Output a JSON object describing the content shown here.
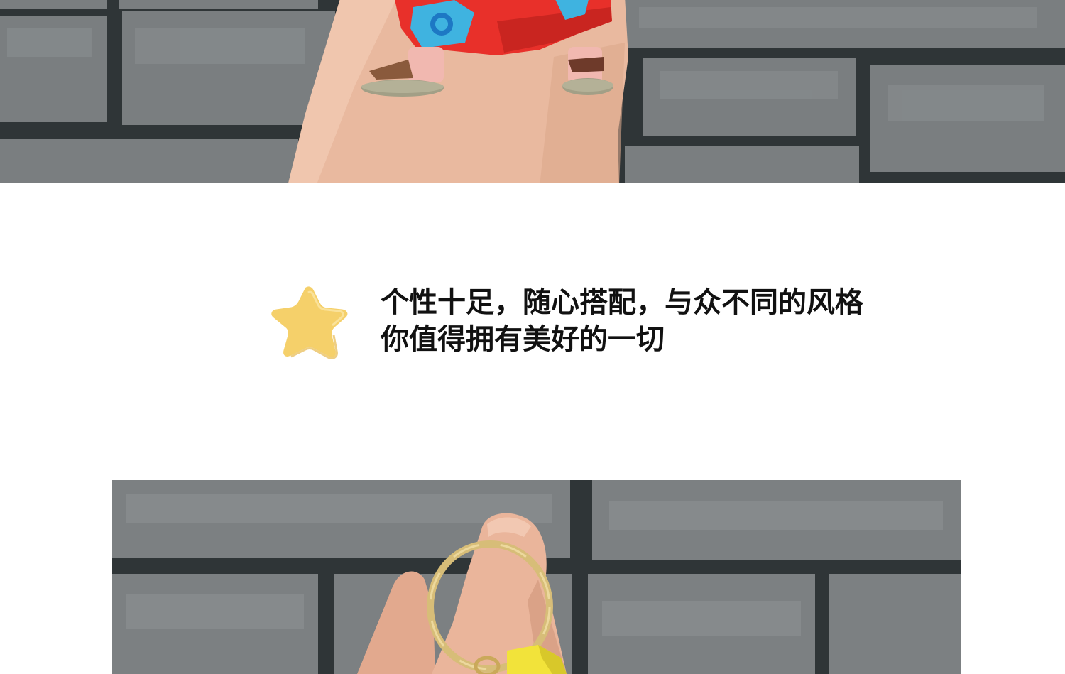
{
  "tagline": {
    "line1": "个性十足，随心搭配，与众不同的风格",
    "line2": "你值得拥有美好的一切",
    "star_color": "#f7d46e"
  },
  "photos": {
    "top": "hand-with-figure-photo",
    "bottom": "keyring-photo"
  },
  "colors": {
    "brick": "#74787a",
    "mortar": "#2c3234",
    "skin": "#e8b59a",
    "robe": "#e8302a",
    "patch": "#3fb3e0",
    "ring": "#d9c07a",
    "strap": "#f2e33a"
  }
}
